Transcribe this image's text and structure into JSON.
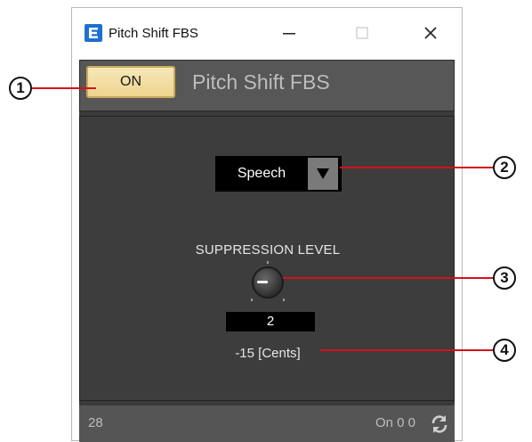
{
  "window": {
    "title": "Pitch Shift FBS",
    "minimize_glyph": "—",
    "maximize_glyph": "☐",
    "close_glyph": "✕"
  },
  "header": {
    "on_button_label": "ON",
    "component_title": "Pitch Shift FBS"
  },
  "mode_select": {
    "value": "Speech"
  },
  "suppression": {
    "label": "SUPPRESSION LEVEL",
    "value": "2",
    "cents_readout": "-15 [Cents]"
  },
  "footer": {
    "left_text": "28",
    "right_text": "On 0 0"
  },
  "callouts": [
    "1",
    "2",
    "3",
    "4"
  ],
  "colors": {
    "accent_leader": "#d4101d",
    "on_button": "#eed58e",
    "panel": "#3d3d3d"
  },
  "icons": [
    "app-icon",
    "dropdown-arrow-icon",
    "sync-icon"
  ]
}
